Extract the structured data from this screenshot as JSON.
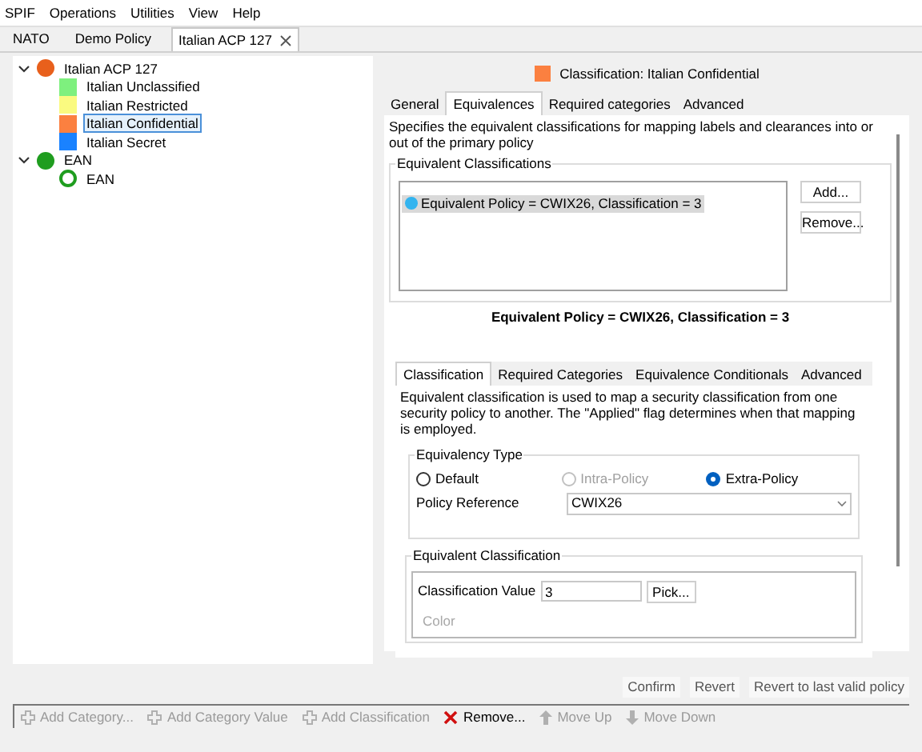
{
  "menu": [
    "SPIF",
    "Operations",
    "Utilities",
    "View",
    "Help"
  ],
  "tabs": [
    {
      "label": "NATO",
      "selected": false,
      "closable": false
    },
    {
      "label": "Demo Policy",
      "selected": false,
      "closable": false
    },
    {
      "label": "Italian ACP 127",
      "selected": true,
      "closable": true
    }
  ],
  "tree": [
    {
      "label": "Italian ACP 127",
      "kind": "orb",
      "color": "#e8601c",
      "expanded": true,
      "selected": false,
      "children": [
        {
          "label": "Italian Unclassified",
          "kind": "square",
          "color": "#7ef07e",
          "selected": false
        },
        {
          "label": "Italian Restricted",
          "kind": "square",
          "color": "#fafa80",
          "selected": false
        },
        {
          "label": "Italian Confidential",
          "kind": "square",
          "color": "#fb8040",
          "selected": true
        },
        {
          "label": "Italian Secret",
          "kind": "square",
          "color": "#1a82ff",
          "selected": false
        }
      ]
    },
    {
      "label": "EAN",
      "kind": "orb",
      "color": "#1f9d1f",
      "expanded": true,
      "selected": false,
      "children": [
        {
          "label": "EAN",
          "kind": "ring",
          "color": "#1f9d1f",
          "selected": false
        }
      ]
    }
  ],
  "detail": {
    "title": "Classification: Italian Confidential",
    "color": "#fb8040",
    "tabs": [
      {
        "label": "General",
        "selected": false
      },
      {
        "label": "Equivalences",
        "selected": true
      },
      {
        "label": "Required categories",
        "selected": false
      },
      {
        "label": "Advanced",
        "selected": false
      }
    ],
    "description": "Specifies the equivalent classifications for mapping labels and clearances into or out of the primary policy",
    "group_title": "Equivalent Classifications",
    "list": [
      {
        "label": "Equivalent Policy = CWIX26, Classification = 3",
        "selected": true
      }
    ],
    "list_buttons": [
      "Add...",
      "Remove..."
    ],
    "summary": "Equivalent Policy = CWIX26, Classification = 3",
    "sub_tabs": [
      {
        "label": "Classification",
        "selected": true
      },
      {
        "label": "Required Categories",
        "selected": false
      },
      {
        "label": "Equivalence Conditionals",
        "selected": false
      },
      {
        "label": "Advanced",
        "selected": false
      }
    ],
    "sub_description": "Equivalent classification is used to map a security classification from one security policy to another. The \"Applied\" flag determines when that mapping is employed.",
    "type_group": {
      "title": "Equivalency Type",
      "options": [
        {
          "label": "Default",
          "selected": false,
          "disabled": false
        },
        {
          "label": "Intra-Policy",
          "selected": false,
          "disabled": true
        },
        {
          "label": "Extra-Policy",
          "selected": true,
          "disabled": false
        }
      ],
      "policy_label": "Policy Reference",
      "policy_value": "CWIX26"
    },
    "class_group": {
      "title": "Equivalent Classification",
      "value_label": "Classification Value",
      "value": "3",
      "pick": "Pick...",
      "color_label": "Color"
    }
  },
  "actions": [
    "Confirm",
    "Revert",
    "Revert to last valid policy"
  ],
  "toolbar": [
    {
      "label": "Add Category...",
      "kind": "add",
      "disabled": true
    },
    {
      "label": "Add Category Value",
      "kind": "add",
      "disabled": true
    },
    {
      "label": "Add Classification",
      "kind": "add",
      "disabled": true
    },
    {
      "label": "Remove...",
      "kind": "remove",
      "disabled": false
    },
    {
      "label": "Move Up",
      "kind": "up",
      "disabled": true
    },
    {
      "label": "Move Down",
      "kind": "down",
      "disabled": true
    }
  ]
}
